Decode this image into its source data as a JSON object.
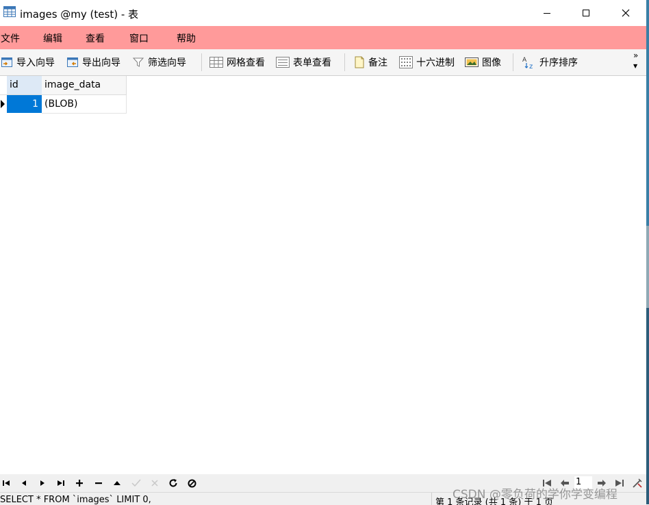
{
  "window": {
    "title": "images @my (test) - 表"
  },
  "menu": {
    "items": [
      "文件",
      "编辑",
      "查看",
      "窗口",
      "帮助"
    ]
  },
  "toolbar": {
    "import_wizard": "导入向导",
    "export_wizard": "导出向导",
    "filter_wizard": "筛选向导",
    "grid_view": "网格查看",
    "form_view": "表单查看",
    "memo": "备注",
    "hex": "十六进制",
    "image": "图像",
    "sort_asc": "升序排序",
    "more": "»"
  },
  "table": {
    "columns": [
      "id",
      "image_data"
    ],
    "rows": [
      {
        "id": "1",
        "image_data": "(BLOB)"
      }
    ]
  },
  "pagination": {
    "page": "1"
  },
  "status": {
    "sql": "SELECT * FROM `images` LIMIT 0,",
    "record_info": "第 1 条记录 (共 1 条) 于 1 页"
  },
  "watermark": "CSDN @零负荷的学你学变编程",
  "colors": {
    "menubar_bg": "#ff9a9a",
    "selected_cell": "#0078d7"
  }
}
